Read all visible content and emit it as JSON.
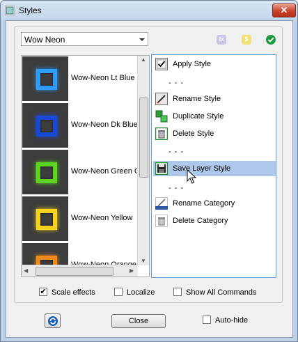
{
  "window": {
    "title": "Styles",
    "close_glyph": "✕"
  },
  "category": {
    "selected": "Wow Neon"
  },
  "header_icons": [
    "fx-icon",
    "dollar-icon",
    "check-icon"
  ],
  "styles": [
    {
      "label": "Wow-Neon Lt Blue",
      "color": "#2e9bf5"
    },
    {
      "label": "Wow-Neon Dk Blue",
      "color": "#1849d6"
    },
    {
      "label": "Wow-Neon Green Glow",
      "color": "#5fd321"
    },
    {
      "label": "Wow-Neon Yellow",
      "color": "#f5d21b"
    },
    {
      "label": "Wow-Neon Orange",
      "color": "#f08a1a"
    }
  ],
  "commands": [
    {
      "label": "Apply Style",
      "icon": "apply-style-icon"
    },
    {
      "label": "- - -"
    },
    {
      "label": "Rename Style",
      "icon": "rename-style-icon"
    },
    {
      "label": "Duplicate Style",
      "icon": "duplicate-style-icon"
    },
    {
      "label": "Delete Style",
      "icon": "delete-style-icon"
    },
    {
      "label": "- - -"
    },
    {
      "label": "Save Layer Style",
      "icon": "save-layer-style-icon",
      "selected": true
    },
    {
      "label": "- - -"
    },
    {
      "label": "Rename Category",
      "icon": "rename-category-icon"
    },
    {
      "label": "Delete Category",
      "icon": "delete-category-icon"
    }
  ],
  "options": [
    {
      "label": "Scale effects",
      "checked": true
    },
    {
      "label": "Localize",
      "checked": false
    },
    {
      "label": "Show All Commands",
      "checked": false
    }
  ],
  "footer": {
    "close_label": "Close",
    "autohide_label": "Auto-hide",
    "autohide_checked": false
  },
  "colors": {
    "accent": "#5c9ad8",
    "selection": "#adc8ea",
    "titlebar": "#c1d5ea"
  }
}
